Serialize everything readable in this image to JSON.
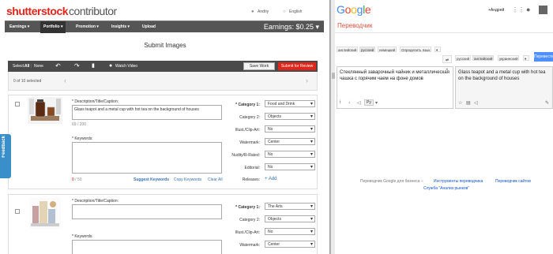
{
  "shutterstock": {
    "logo_main": "shutterstock",
    "logo_sub": "contributor",
    "user": "Andriy",
    "language": "English",
    "nav": [
      "Earnings",
      "Portfolio",
      "Promotion",
      "Insights",
      "Upload"
    ],
    "earnings_label": "Earnings: $0.25",
    "page_title": "Submit Images",
    "toolbar": {
      "select_label": "Select:",
      "select_all": "All",
      "select_none": "None",
      "watch_video": "Watch Video",
      "save_work": "Save Work",
      "submit": "Submit for Review"
    },
    "selected_count": "0 of 10 selected",
    "card1": {
      "desc_label": "* Description/Title/Caption:",
      "desc_value": "Glass teapot and a metal cup with hot tea on the background of houses",
      "char_count": "69 / 200",
      "keywords_label": "* Keywords:",
      "kw_count_red": "0",
      "kw_count_rest": "/ 50",
      "suggest": "Suggest Keywords",
      "copy": "Copy Keywords",
      "clear": "Clear All",
      "cat1_label": "* Category 1:",
      "cat1_value": "Food and Drink",
      "cat2_label": "Category 2:",
      "cat2_value": "Objects",
      "illus_label": "Illust./Clip-Art:",
      "illus_value": "No",
      "watermark_label": "Watermark:",
      "watermark_value": "Center",
      "nudity_label": "Nudity/R-Rated:",
      "nudity_value": "No",
      "editorial_label": "Editorial:",
      "editorial_value": "No",
      "releases_label": "Releases:",
      "add": "Add"
    },
    "card2": {
      "desc_label": "* Description/Title/Caption:",
      "keywords_label": "* Keywords:",
      "cat1_label": "* Category 1:",
      "cat1_value": "The Arts",
      "cat2_label": "Category 2:",
      "cat2_value": "Objects",
      "illus_label": "Illust./Clip-Art:",
      "illus_value": "No",
      "watermark_label": "Watermark:",
      "watermark_value": "Center"
    },
    "feedback": "Feedback"
  },
  "google": {
    "logo_letters": [
      "G",
      "o",
      "o",
      "g",
      "l",
      "e"
    ],
    "logo_colors": [
      "#4285f4",
      "#ea4335",
      "#fbbc05",
      "#4285f4",
      "#34a853",
      "#ea4335"
    ],
    "user": "+Андрей",
    "page_title": "Переводчик",
    "src_langs": [
      "английский",
      "русский",
      "немецкий",
      "Определить язык"
    ],
    "tgt_langs": [
      "русский",
      "английский",
      "украинский"
    ],
    "translate_btn": "Перевести",
    "source_text": "Стеклянный заварочный чайник и металлическая чашка с горячим чаем на фоне домов",
    "target_text": "Glass teapot and a metal cup with hot tea on the background of houses",
    "translit": "Ру",
    "footer_prefix": "Переводчик Google для бизнеса –",
    "footer_links": [
      "Инструменты переводчика",
      "Переводчик сайтов",
      "Служба \"Анализ рынков\""
    ]
  }
}
